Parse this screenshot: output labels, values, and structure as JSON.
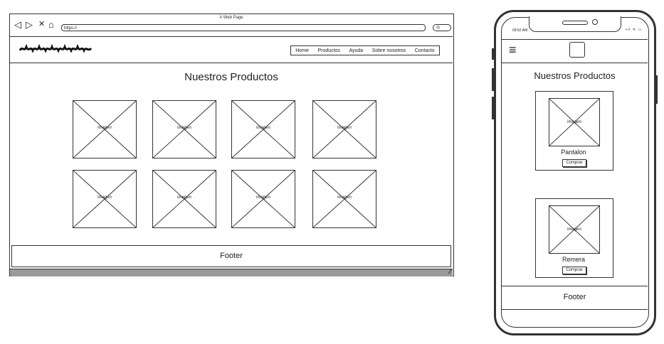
{
  "desktop": {
    "window_title": "A Web Page",
    "url": "https://",
    "nav_icons": {
      "back": "◁",
      "forward": "▷",
      "close": "✕",
      "home": "⌂",
      "search": "🔍"
    },
    "nav": [
      "Home",
      "Productos",
      "Ayuda",
      "Sobre nosotros",
      "Contacto"
    ],
    "page_title": "Nuestros Productos",
    "image_label": "imagen",
    "product_grid": {
      "rows": 2,
      "columns": 4
    },
    "footer": "Footer"
  },
  "mobile": {
    "time": "09:52 AM",
    "status_icons": "•ıl ᯤ ▭",
    "page_title": "Nuestros Productos",
    "image_label": "imagen",
    "products": [
      {
        "name": "Pantalon",
        "button": "Comprar"
      },
      {
        "name": "Remera",
        "button": "Comprar"
      }
    ],
    "footer": "Footer"
  }
}
